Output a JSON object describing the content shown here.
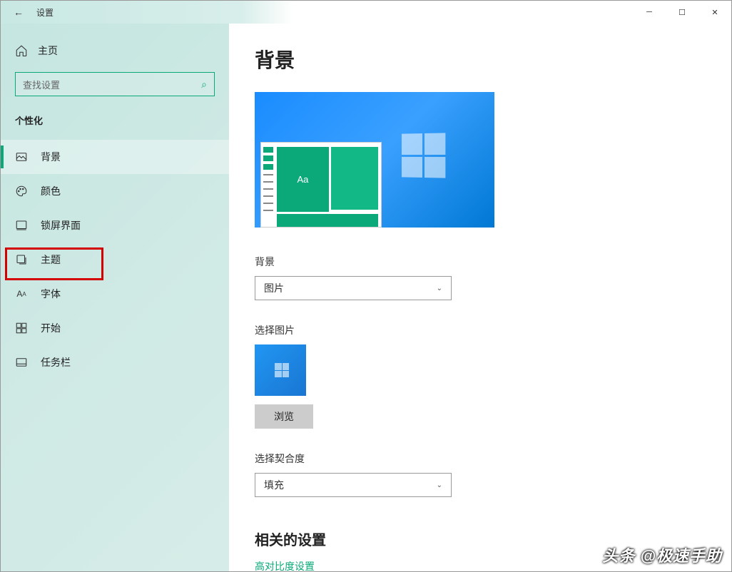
{
  "window": {
    "title": "设置"
  },
  "sidebar": {
    "home": "主页",
    "search_placeholder": "查找设置",
    "section": "个性化",
    "items": [
      {
        "label": "背景"
      },
      {
        "label": "颜色"
      },
      {
        "label": "锁屏界面"
      },
      {
        "label": "主题"
      },
      {
        "label": "字体"
      },
      {
        "label": "开始"
      },
      {
        "label": "任务栏"
      }
    ]
  },
  "main": {
    "title": "背景",
    "preview_sample": "Aa",
    "bg_label": "背景",
    "bg_value": "图片",
    "choose_pic": "选择图片",
    "browse": "浏览",
    "fit_label": "选择契合度",
    "fit_value": "填充",
    "related_title": "相关的设置",
    "link_contrast": "高对比度设置"
  },
  "watermark": "头条 @极速手助"
}
